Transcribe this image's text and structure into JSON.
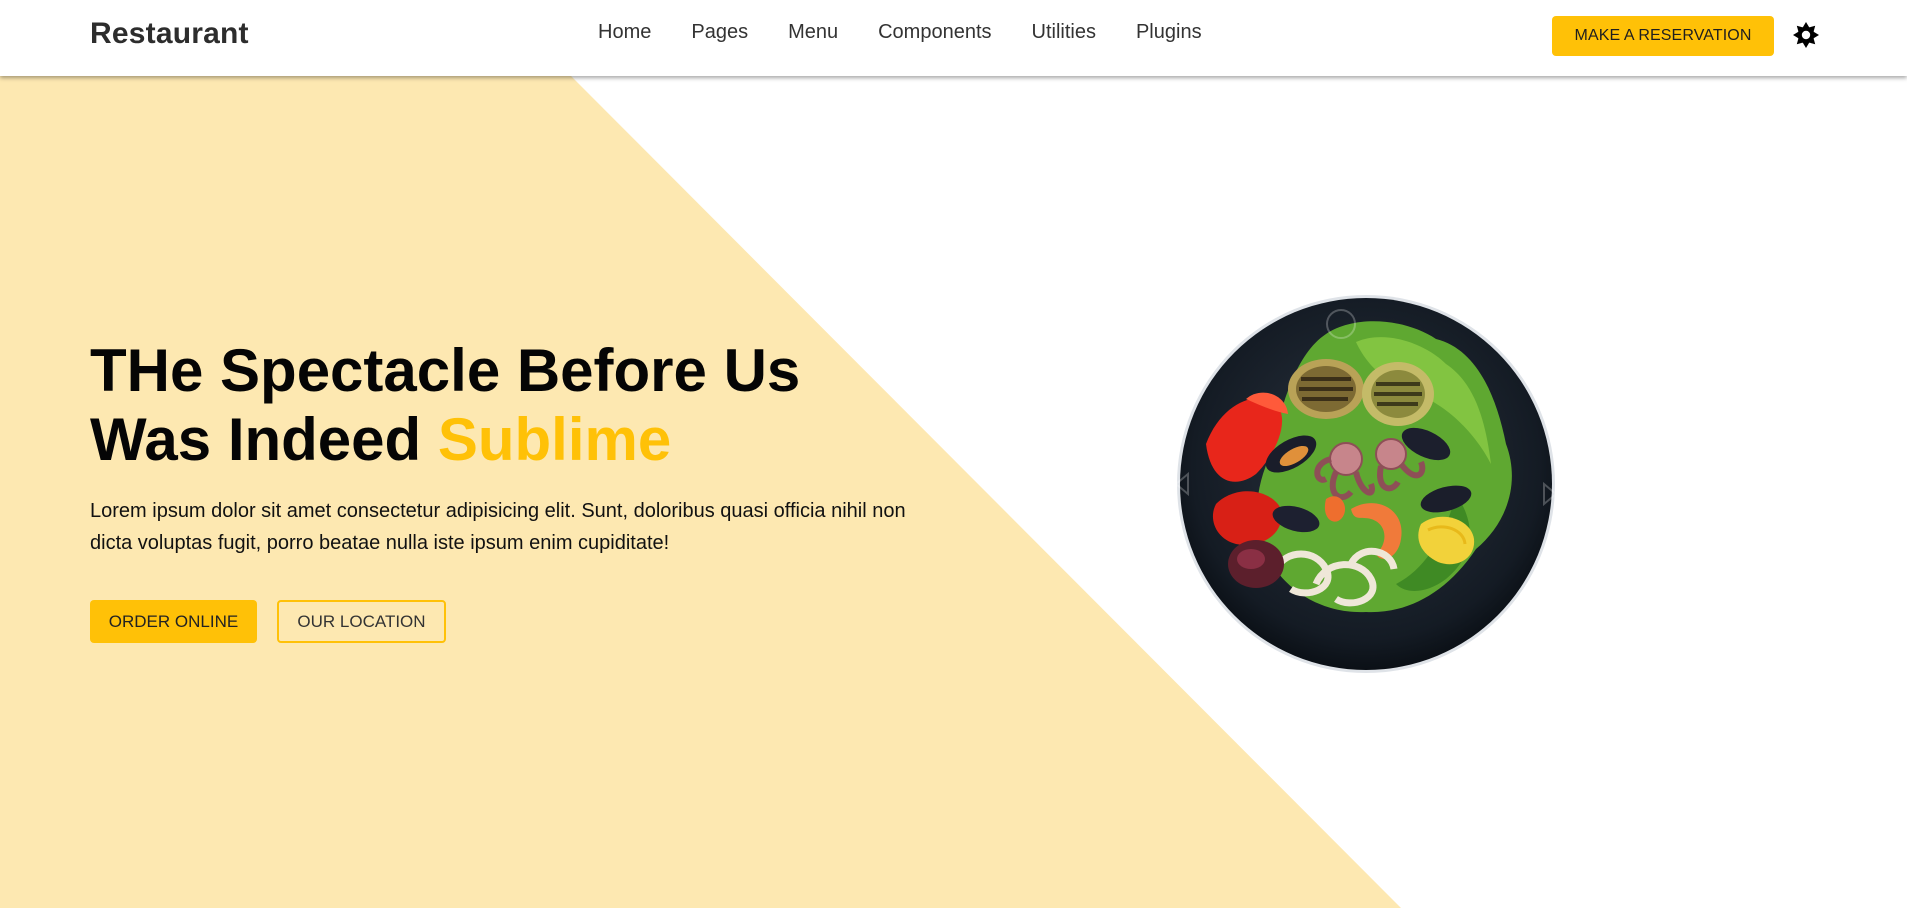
{
  "header": {
    "brand": "Restaurant",
    "nav": [
      "Home",
      "Pages",
      "Menu",
      "Components",
      "Utilities",
      "Plugins"
    ],
    "reserve_label": "MAKE A RESERVATION",
    "theme_icon": "sun-gear-icon"
  },
  "hero": {
    "title_line1": "THe Spectacle Before Us",
    "title_line2_prefix": "Was Indeed ",
    "title_line2_accent": "Sublime",
    "description": "Lorem ipsum dolor sit amet consectetur adipisicing elit. Sunt, doloribus quasi officia nihil non dicta voluptas fugit, porro beatae nulla iste ipsum enim cupiditate!",
    "order_label": "ORDER ONLINE",
    "location_label": "OUR LOCATION",
    "image": "seafood-plate-image"
  },
  "colors": {
    "accent": "#ffc107",
    "hero_bg": "#fde8b1",
    "text_dark": "#2d2d2d"
  }
}
